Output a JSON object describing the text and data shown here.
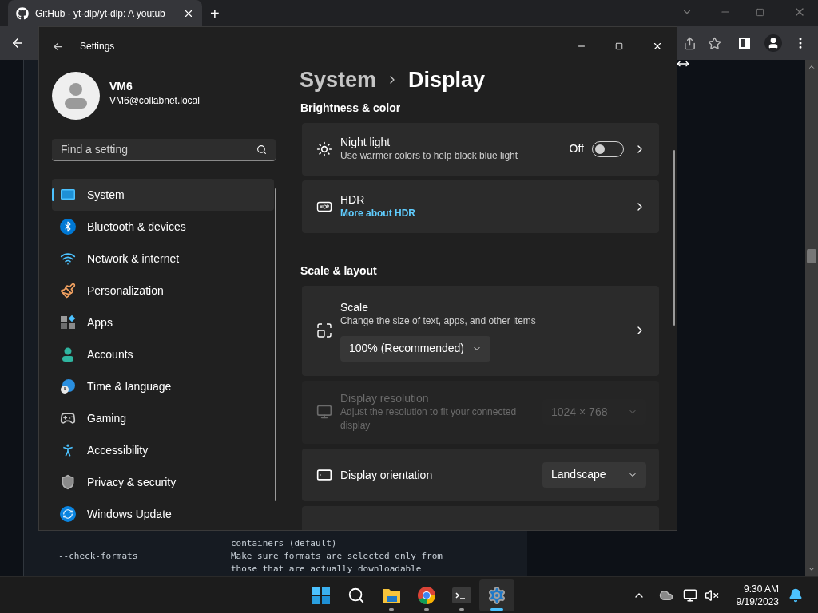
{
  "browser": {
    "tab_title": "GitHub - yt-dlp/yt-dlp: A youtub",
    "new_tab": "+",
    "code_lines": [
      {
        "description": "containers (default)"
      },
      {
        "option": "--check-formats",
        "description": "Make sure formats are selected only from"
      },
      {
        "description": "those that are actually downloadable"
      }
    ]
  },
  "settings": {
    "title": "Settings",
    "user": {
      "name": "VM6",
      "email": "VM6@collabnet.local"
    },
    "search": {
      "placeholder": "Find a setting"
    },
    "nav_items": [
      {
        "label": "System",
        "selected": true
      },
      {
        "label": "Bluetooth & devices",
        "selected": false
      },
      {
        "label": "Network & internet",
        "selected": false
      },
      {
        "label": "Personalization",
        "selected": false
      },
      {
        "label": "Apps",
        "selected": false
      },
      {
        "label": "Accounts",
        "selected": false
      },
      {
        "label": "Time & language",
        "selected": false
      },
      {
        "label": "Gaming",
        "selected": false
      },
      {
        "label": "Accessibility",
        "selected": false
      },
      {
        "label": "Privacy & security",
        "selected": false
      },
      {
        "label": "Windows Update",
        "selected": false
      }
    ],
    "breadcrumb": [
      "System",
      "Display"
    ],
    "sections": [
      {
        "heading": "Brightness & color",
        "cards": [
          {
            "kind": "toggle",
            "title": "Night light",
            "description": "Use warmer colors to help block blue light",
            "toggle_label": "Off",
            "on": false,
            "disabled": false
          },
          {
            "kind": "link",
            "title": "HDR",
            "link": "More about HDR",
            "disabled": false
          }
        ]
      },
      {
        "heading": "Scale & layout",
        "cards": [
          {
            "kind": "stacked-dropdown",
            "title": "Scale",
            "description": "Change the size of text, apps, and other items",
            "value": "100% (Recommended)",
            "disabled": false
          },
          {
            "kind": "dropdown",
            "title": "Display resolution",
            "description": "Adjust the resolution to fit your connected display",
            "value": "1024 × 768",
            "disabled": true
          },
          {
            "kind": "dropdown",
            "title": "Display orientation",
            "value": "Landscape",
            "disabled": false
          }
        ]
      }
    ]
  },
  "taskbar": {
    "apps": [
      {
        "running": false,
        "selected": false
      },
      {
        "running": false,
        "selected": false
      },
      {
        "running": true,
        "selected": false
      },
      {
        "running": true,
        "selected": false
      },
      {
        "running": true,
        "selected": false
      },
      {
        "running": true,
        "selected": true
      }
    ],
    "time": "9:30 AM",
    "date": "9/19/2023"
  }
}
